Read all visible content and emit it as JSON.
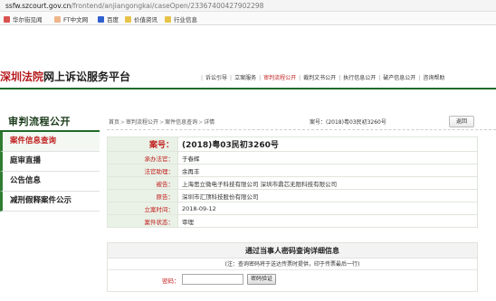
{
  "browser": {
    "url_host": "ssfw.szcourt.gov.cn",
    "url_path": "/frontend/anjiangongkai/caseOpen/23367400427902298",
    "bookmarks": [
      {
        "label": "华尔街见闻",
        "icon": "news-icon",
        "color": "#d9534f"
      },
      {
        "label": "FT中文网",
        "icon": "ft-icon",
        "color": "#f0b48a"
      },
      {
        "label": "百度",
        "icon": "baidu-icon",
        "color": "#3060d0"
      },
      {
        "label": "价值资讯",
        "icon": "folder-icon",
        "color": "#e8c34a"
      },
      {
        "label": "行业信息",
        "icon": "folder-icon",
        "color": "#e8c34a"
      }
    ]
  },
  "site": {
    "logo_red": "深圳法院",
    "logo_dark": "网上诉讼服务平台",
    "nav": [
      "诉讼引导",
      "立案服务",
      "审判流程公开",
      "裁判文书公开",
      "执行信息公开",
      "破产信息公开",
      "咨询帮助"
    ],
    "active_nav_index": 2,
    "accent_color": "#1f6b28",
    "highlight_color": "#c0201e"
  },
  "sidebar": {
    "title": "审判流程公开",
    "items": [
      "案件信息查询",
      "庭审直播",
      "公告信息",
      "减刑假释案件公示"
    ],
    "active_index": 0
  },
  "main": {
    "breadcrumb": [
      "首页",
      "审判流程公开",
      "案件信息查询",
      "详情"
    ],
    "case_ref": "案号：(2018)粤03民初3260号",
    "back_label": "返回",
    "case_info": [
      {
        "label": "案号：",
        "value": "(2018)粤03民初3260号"
      },
      {
        "label": "承办法官：",
        "value": "于春辉"
      },
      {
        "label": "法官助理：",
        "value": "余再丰"
      },
      {
        "label": "被告：",
        "value": "上海思立微电子科技有限公司  深圳市鼎芯无限科技有限公司"
      },
      {
        "label": "原告：",
        "value": "深圳市汇顶科技股份有限公司"
      },
      {
        "label": "立案时间：",
        "value": "2018-09-12"
      },
      {
        "label": "案件状态：",
        "value": "审理"
      }
    ],
    "query": {
      "title": "通过当事人密码查询详细信息",
      "note": "(注：查询密码将于送达传票时提供，印于传票最后一行)",
      "password_label": "密码：",
      "password_value": "",
      "submit_label": "密码验证"
    }
  }
}
